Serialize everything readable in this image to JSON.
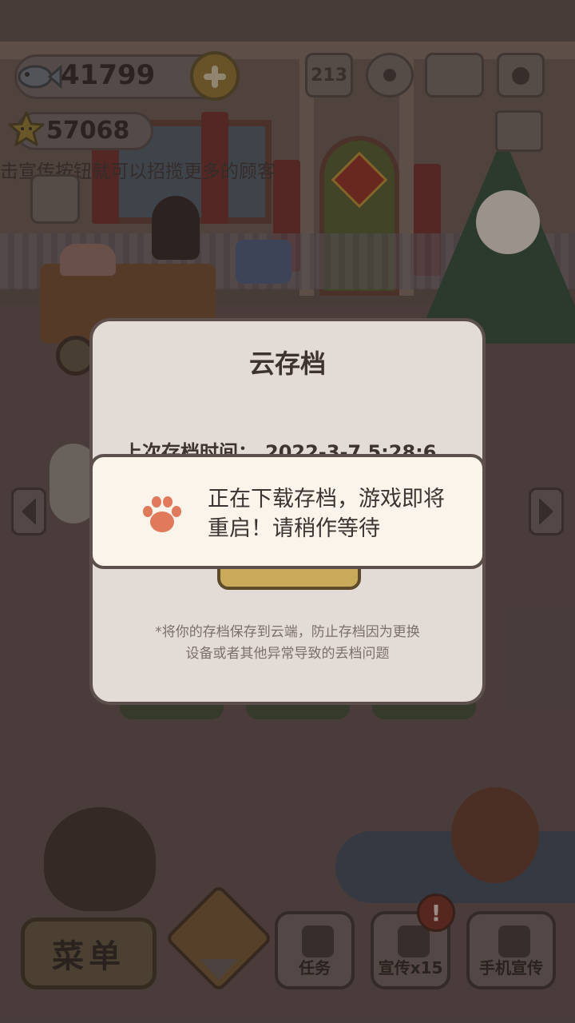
{
  "hud": {
    "fish_count": "41799",
    "star_count": "57068",
    "hint": "击宣传按钮就可以招揽更多的顾客",
    "rank_icon_text": "213"
  },
  "dialog": {
    "title": "云存档",
    "last_save_label": "上次存档时间：",
    "last_save_value": "2022-3-7 5:28:6",
    "note_line1": "*将你的存档保存到云端，防止存档因为更换",
    "note_line2": "设备或者其他异常导致的丢档问题"
  },
  "toast": {
    "line1": "正在下载存档，游戏即将",
    "line2": "重启！请稍作等待"
  },
  "bottom_bar": {
    "menu_label": "菜单",
    "tasks_label": "任务",
    "promote_label": "宣传x15",
    "phone_promote_label": "手机宣传",
    "badge": "!"
  },
  "colors": {
    "dialog_bg": "#e3dbd6",
    "toast_bg": "#fbf4ea",
    "paw": "#e07a5a",
    "overlay": "rgba(40,28,26,0.35)"
  },
  "icons": [
    "fish-icon",
    "plus-icon",
    "star-icon",
    "rank-icon",
    "gear-icon",
    "book-icon",
    "camera-icon",
    "news-icon",
    "shop-icon",
    "chevron-left-icon",
    "chevron-right-icon",
    "paw-icon",
    "checklist-icon",
    "phone-icon"
  ]
}
